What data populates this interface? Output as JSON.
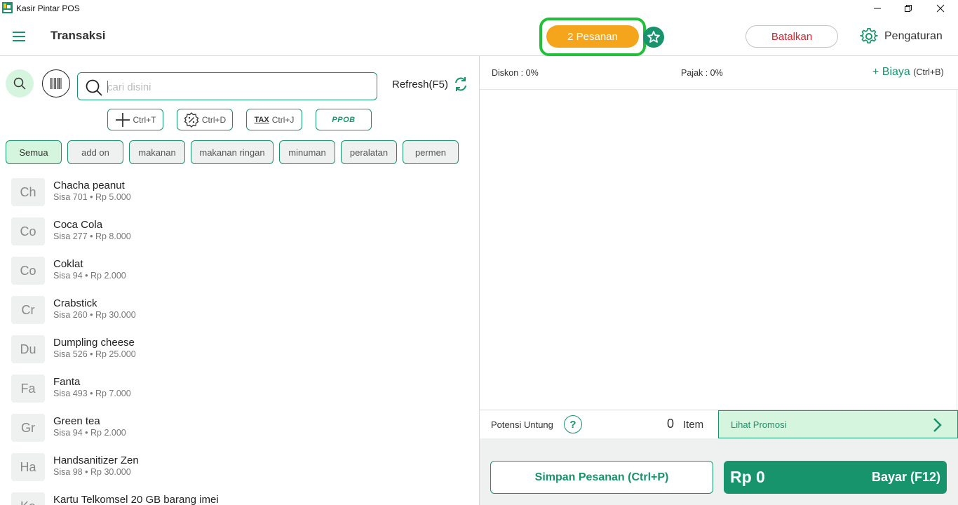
{
  "window": {
    "title": "Kasir Pintar POS"
  },
  "header": {
    "title": "Transaksi",
    "orders_label": "2 Pesanan",
    "cancel_label": "Batalkan",
    "settings_label": "Pengaturan"
  },
  "search": {
    "placeholder": "cari disini",
    "refresh_label": "Refresh(F5)"
  },
  "shortcuts": [
    {
      "icon": "plus-icon",
      "label": "Ctrl+T"
    },
    {
      "icon": "discount-badge-icon",
      "label": "Ctrl+D"
    },
    {
      "icon": "tax-icon",
      "label": "Ctrl+J",
      "icon_text": "TAX"
    },
    {
      "icon": "ppob-logo",
      "label": "PPOB"
    }
  ],
  "categories": [
    "Semua",
    "add on",
    "makanan",
    "makanan ringan",
    "minuman",
    "peralatan",
    "permen"
  ],
  "products": [
    {
      "initials": "Ch",
      "name": "Chacha peanut",
      "sub": "Sisa 701 • Rp 5.000"
    },
    {
      "initials": "Co",
      "name": "Coca Cola",
      "sub": "Sisa 277 • Rp 8.000"
    },
    {
      "initials": "Co",
      "name": "Coklat",
      "sub": "Sisa 94 • Rp 2.000"
    },
    {
      "initials": "Cr",
      "name": "Crabstick",
      "sub": "Sisa 260 • Rp 30.000"
    },
    {
      "initials": "Du",
      "name": "Dumpling cheese",
      "sub": "Sisa 526 • Rp 25.000"
    },
    {
      "initials": "Fa",
      "name": "Fanta",
      "sub": "Sisa 493 • Rp 7.000"
    },
    {
      "initials": "Gr",
      "name": "Green tea",
      "sub": "Sisa 94 • Rp 2.000"
    },
    {
      "initials": "Ha",
      "name": "Handsanitizer Zen",
      "sub": "Sisa 98 • Rp 30.000"
    },
    {
      "initials": "Ka",
      "name": "Kartu Telkomsel 20 GB barang imei",
      "sub": ""
    }
  ],
  "cart": {
    "diskon": "Diskon : 0%",
    "pajak": "Pajak : 0%",
    "biaya_label": "+ Biaya",
    "biaya_hint": "(Ctrl+B)",
    "potensi_label": "Potensi Untung",
    "item_count": "0",
    "item_label": "Item",
    "promo_label": "Lihat Promosi",
    "save_label": "Simpan Pesanan (Ctrl+P)",
    "total": "Rp 0",
    "pay_label": "Bayar (F12)"
  },
  "colors": {
    "primary": "#17946b",
    "accent_orange": "#f5a51c",
    "danger": "#d6242e",
    "highlight_green": "#22c03a",
    "light_green": "#d5f5df"
  }
}
